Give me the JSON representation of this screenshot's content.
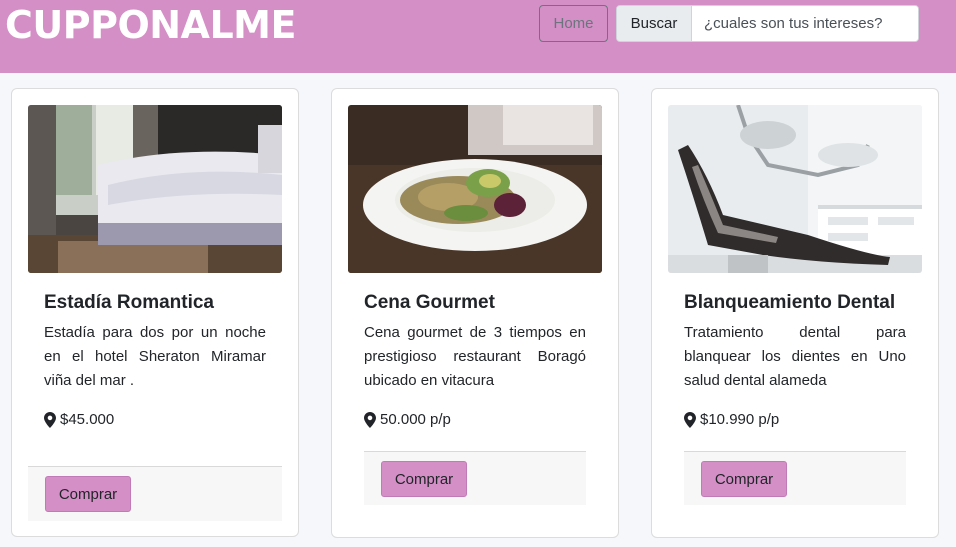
{
  "header": {
    "brand": "CUPPONALME",
    "home_label": "Home",
    "search_label": "Buscar",
    "search_placeholder": "¿cuales son tus intereses?"
  },
  "cards": [
    {
      "title": "Estadía Romantica",
      "text": "Estadía para dos por un noche en el hotel Sheraton Miramar viña del mar .",
      "price": "$45.000",
      "button": "Comprar",
      "image": "bedroom-photo"
    },
    {
      "title": "Cena Gourmet",
      "text": "Cena gourmet de 3 tiempos en prestigioso restaurant Boragó ubicado en vitacura",
      "price": "50.000 p/p",
      "button": "Comprar",
      "image": "gourmet-dish-photo"
    },
    {
      "title": "Blanqueamiento Dental",
      "text": "Tratamiento dental para blanquear los dientes en Uno salud dental alameda",
      "price": "$10.990 p/p",
      "button": "Comprar",
      "image": "dental-chair-photo"
    }
  ],
  "colors": {
    "header_bg": "#d48fc6",
    "button_bg": "#d48fc6",
    "page_bg": "#f5f7fa"
  }
}
